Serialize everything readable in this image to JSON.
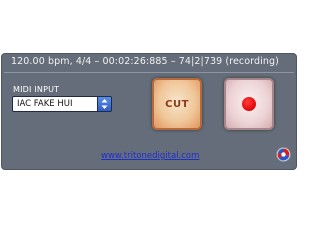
{
  "status": {
    "text": "120.00 bpm, 4/4  –  00:02:26:885  –  74|2|739  (recording)"
  },
  "midi_input": {
    "label": "MIDI INPUT",
    "selected": "IAC FAKE HUI"
  },
  "buttons": {
    "cut_label": "CUT",
    "record_icon": "record-dot-icon"
  },
  "footer": {
    "link_text": "www.tritonedigital.com",
    "logo_icon": "tritone-logo-icon"
  },
  "colors": {
    "window_bg": "#646d79",
    "cut_text": "#8e3a16",
    "record_dot": "#e60d0d",
    "link": "#1e2fd0"
  }
}
